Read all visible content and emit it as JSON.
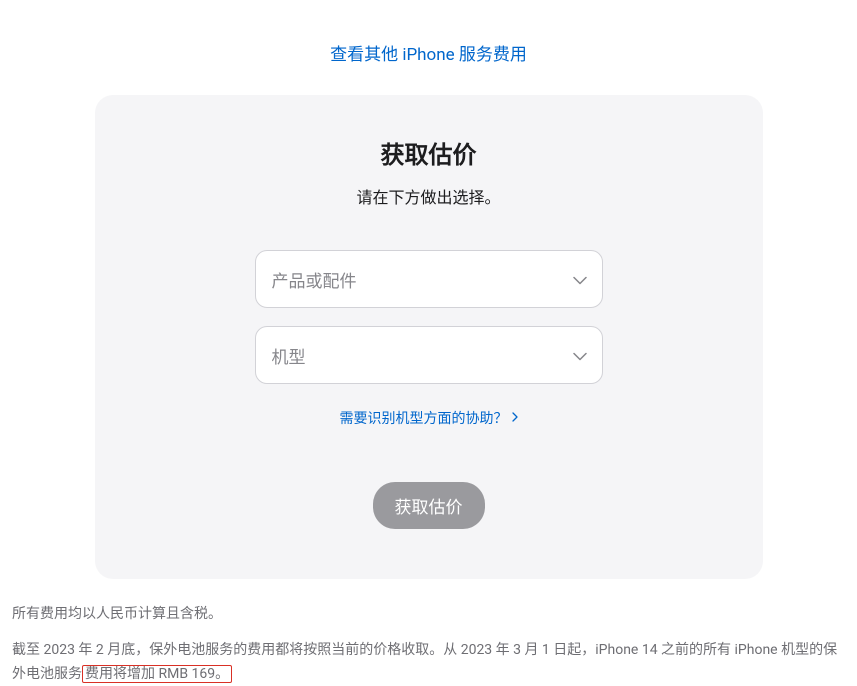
{
  "topLink": "查看其他 iPhone 服务费用",
  "card": {
    "title": "获取估价",
    "subtitle": "请在下方做出选择。",
    "select1Placeholder": "产品或配件",
    "select2Placeholder": "机型",
    "helpLink": "需要识别机型方面的协助？",
    "submitLabel": "获取估价"
  },
  "footer": {
    "note1": "所有费用均以人民币计算且含税。",
    "note2Part1": "截至 2023 年 2 月底，保外电池服务的费用都将按照当前的价格收取。从 2023 年 3 月 1 日起，iPhone 14 之前的所有 iPhone 机型的保外电池服务",
    "note2Highlight": "费用将增加 RMB 169。"
  }
}
